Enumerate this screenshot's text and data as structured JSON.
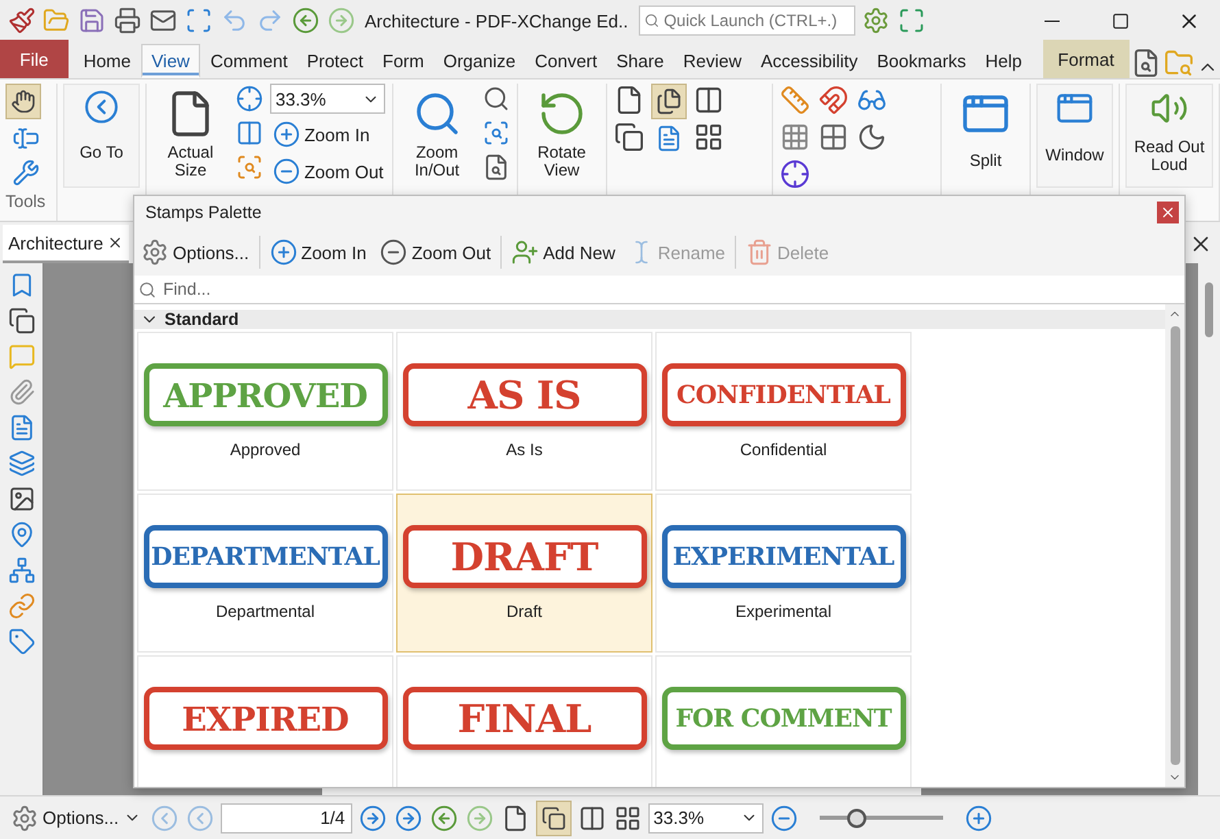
{
  "window": {
    "title": "Architecture - PDF-XChange Ed..",
    "quick_launch": {
      "placeholder": "Quick Launch (CTRL+.)"
    }
  },
  "ribbon_tabs": [
    {
      "label": "File",
      "kind": "file",
      "selected": false
    },
    {
      "label": "Home",
      "kind": "tab",
      "selected": false
    },
    {
      "label": "View",
      "kind": "tab",
      "selected": true
    },
    {
      "label": "Comment",
      "kind": "tab",
      "selected": false
    },
    {
      "label": "Protect",
      "kind": "tab",
      "selected": false
    },
    {
      "label": "Form",
      "kind": "tab",
      "selected": false
    },
    {
      "label": "Organize",
      "kind": "tab",
      "selected": false
    },
    {
      "label": "Convert",
      "kind": "tab",
      "selected": false
    },
    {
      "label": "Share",
      "kind": "tab",
      "selected": false
    },
    {
      "label": "Review",
      "kind": "tab",
      "selected": false
    },
    {
      "label": "Accessibility",
      "kind": "tab",
      "selected": false
    },
    {
      "label": "Bookmarks",
      "kind": "tab",
      "selected": false
    },
    {
      "label": "Help",
      "kind": "tab",
      "selected": false
    },
    {
      "label": "Format",
      "kind": "contextual",
      "selected": false
    }
  ],
  "ribbon": {
    "tools_group": "Tools",
    "go_to": "Go To",
    "actual_size": "Actual Size",
    "zoom_value": "33.3%",
    "zoom_in": "Zoom In",
    "zoom_out": "Zoom Out",
    "zoom_in_out": "Zoom In/Out",
    "rotate_view": "Rotate View",
    "split": "Split",
    "window": "Window",
    "read_out_loud": "Read Out Loud"
  },
  "document_tab": {
    "label": "Architecture",
    "selected": true
  },
  "stamps_palette": {
    "title": "Stamps Palette",
    "toolbar": [
      {
        "label": "Options...",
        "kind": "options",
        "disabled": false
      },
      {
        "label": "Zoom In",
        "kind": "zoom_in",
        "disabled": false
      },
      {
        "label": "Zoom Out",
        "kind": "zoom_out",
        "disabled": false
      },
      {
        "label": "Add New",
        "kind": "add",
        "disabled": false
      },
      {
        "label": "Rename",
        "kind": "rename",
        "disabled": true
      },
      {
        "label": "Delete",
        "kind": "delete",
        "disabled": true
      }
    ],
    "find": {
      "placeholder": "Find..."
    },
    "section": {
      "label": "Standard",
      "expanded": true
    },
    "stamps": [
      {
        "stamp_text": "APPROVED",
        "caption": "Approved",
        "color": "#5ea344",
        "selected": false
      },
      {
        "stamp_text": "AS IS",
        "caption": "As Is",
        "color": "#d4412f",
        "selected": false
      },
      {
        "stamp_text": "CONFIDENTIAL",
        "caption": "Confidential",
        "color": "#d4412f",
        "selected": false
      },
      {
        "stamp_text": "DEPARTMENTAL",
        "caption": "Departmental",
        "color": "#2a6cb5",
        "selected": false
      },
      {
        "stamp_text": "DRAFT",
        "caption": "Draft",
        "color": "#d4412f",
        "selected": true
      },
      {
        "stamp_text": "EXPERIMENTAL",
        "caption": "Experimental",
        "color": "#2a6cb5",
        "selected": false
      },
      {
        "stamp_text": "EXPIRED",
        "color": "#d4412f",
        "selected": false
      },
      {
        "stamp_text": "FINAL",
        "color": "#d4412f",
        "selected": false
      },
      {
        "stamp_text": "FOR COMMENT",
        "color": "#5ea344",
        "selected": false
      }
    ]
  },
  "status_bar": {
    "options": "Options...",
    "page": "1/4",
    "zoom_value": "33.3%",
    "zoom_slider": {
      "level": 0.3
    }
  }
}
